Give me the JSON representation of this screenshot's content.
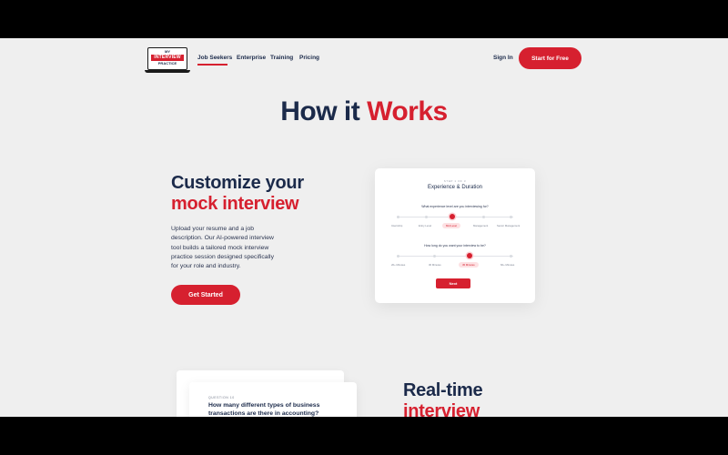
{
  "logo": {
    "line1": "MY",
    "line2": "INTERVIEW",
    "line3": "PRACTICE"
  },
  "nav": {
    "items": [
      "Job Seekers",
      "Enterprise",
      "Training",
      "Pricing"
    ],
    "sign_in": "Sign In",
    "cta": "Start for Free"
  },
  "hero": {
    "title_main": "How it ",
    "title_accent": "Works"
  },
  "section1": {
    "title_line1": "Customize your",
    "title_line2": "mock interview",
    "body": "Upload your resume and a job description. Our AI-powered interview tool builds a tailored mock interview practice session designed specifically for your role and industry.",
    "button": "Get Started"
  },
  "card": {
    "step": "STEP 1 OF 3",
    "title": "Experience & Duration",
    "q1": "What experience level are you interviewing for?",
    "levels": [
      "Internship",
      "Entry Level",
      "Mid Level",
      "Management",
      "Senior Management"
    ],
    "level_selected": "Mid Level",
    "q2": "How long do you want your interview to be?",
    "durations": [
      "20+ Minutes",
      "30 Minutes",
      "45 Minutes",
      "60+ Minutes"
    ],
    "duration_selected": "45 Minutes",
    "next": "Next"
  },
  "section2": {
    "question_label": "QUESTION 10",
    "question": "How many different types of business transactions are there in accounting?",
    "title_line1": "Real-time",
    "title_line2": "interview"
  },
  "colors": {
    "accent": "#d6202f",
    "navy": "#1b2a4a",
    "bg": "#efefef"
  }
}
